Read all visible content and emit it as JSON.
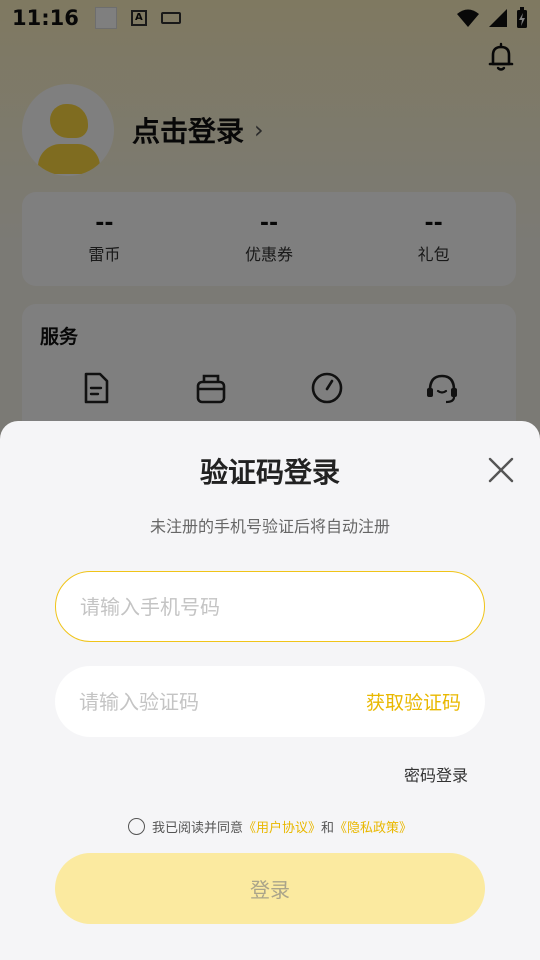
{
  "status_bar": {
    "time": "11:16"
  },
  "profile": {
    "login_hint": "点击登录",
    "chevron": "›"
  },
  "stats": [
    {
      "value": "--",
      "label": "雷币"
    },
    {
      "value": "--",
      "label": "优惠券"
    },
    {
      "value": "--",
      "label": "礼包"
    }
  ],
  "services": {
    "title": "服务"
  },
  "login_sheet": {
    "title": "验证码登录",
    "subtitle": "未注册的手机号验证后将自动注册",
    "phone_placeholder": "请输入手机号码",
    "phone_value": "",
    "code_placeholder": "请输入验证码",
    "code_value": "",
    "get_code_label": "获取验证码",
    "password_login_label": "密码登录",
    "agreement": {
      "prefix": "我已阅读并同意",
      "user_agreement": "《用户协议》",
      "conjunction": "和",
      "privacy_policy": "《隐私政策》",
      "checked": false
    },
    "login_button_label": "登录"
  },
  "colors": {
    "accent": "#e9b800",
    "button_disabled": "#fbeaa0",
    "phone_border": "#f0c419"
  }
}
